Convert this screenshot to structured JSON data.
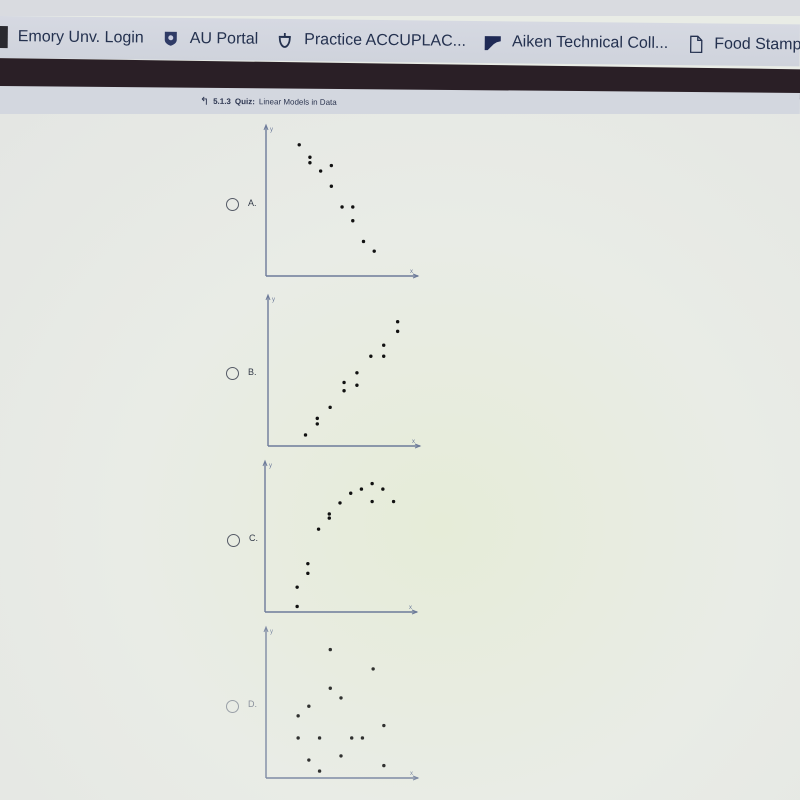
{
  "browser": {
    "bookmarks": [
      {
        "label": "Emory Unv. Login",
        "icon": "bookmark-edge-icon"
      },
      {
        "label": "AU Portal",
        "icon": "shield-icon"
      },
      {
        "label": "Practice ACCUPLAC...",
        "icon": "acorn-icon"
      },
      {
        "label": "Aiken Technical Coll...",
        "icon": "college-logo-icon"
      },
      {
        "label": "Food Stamps",
        "icon": "document-icon"
      }
    ]
  },
  "quiz": {
    "back_icon": "↰",
    "number": "5.1.3",
    "label": "Quiz:",
    "title": "Linear Models in Data"
  },
  "options": [
    {
      "letter": "A.",
      "xlabel": "x",
      "ylabel": "y",
      "points": [
        [
          3.1,
          9.5
        ],
        [
          4.1,
          8.6
        ],
        [
          4.1,
          8.2
        ],
        [
          5.1,
          7.6
        ],
        [
          6.1,
          8.0
        ],
        [
          6.1,
          6.5
        ],
        [
          7.1,
          5.0
        ],
        [
          8.1,
          5.0
        ],
        [
          8.1,
          4.0
        ],
        [
          9.1,
          2.5
        ],
        [
          10.1,
          1.8
        ]
      ]
    },
    {
      "letter": "B.",
      "xlabel": "x",
      "ylabel": "y",
      "points": [
        [
          3.5,
          0.8
        ],
        [
          4.6,
          1.6
        ],
        [
          4.6,
          2.0
        ],
        [
          5.8,
          2.8
        ],
        [
          7.1,
          4.0
        ],
        [
          7.1,
          4.6
        ],
        [
          8.3,
          4.4
        ],
        [
          8.3,
          5.3
        ],
        [
          9.6,
          6.5
        ],
        [
          10.8,
          7.3
        ],
        [
          10.8,
          6.5
        ],
        [
          12.1,
          8.3
        ],
        [
          12.1,
          9.0
        ]
      ]
    },
    {
      "letter": "C.",
      "xlabel": "x",
      "ylabel": "y",
      "points": [
        [
          3.0,
          0.4
        ],
        [
          3.0,
          1.8
        ],
        [
          4.0,
          2.8
        ],
        [
          4.0,
          3.5
        ],
        [
          5.0,
          6.0
        ],
        [
          6.0,
          6.8
        ],
        [
          6.0,
          7.1
        ],
        [
          7.0,
          7.9
        ],
        [
          8.0,
          8.6
        ],
        [
          9.0,
          8.9
        ],
        [
          10.0,
          9.3
        ],
        [
          11.0,
          8.9
        ],
        [
          10.0,
          8.0
        ],
        [
          12.0,
          8.0
        ]
      ]
    },
    {
      "letter": "D.",
      "xlabel": "x",
      "ylabel": "y",
      "points": [
        [
          6.0,
          9.3
        ],
        [
          10.0,
          7.9
        ],
        [
          6.0,
          6.5
        ],
        [
          7.0,
          5.8
        ],
        [
          4.0,
          5.2
        ],
        [
          3.0,
          4.5
        ],
        [
          11.0,
          3.8
        ],
        [
          3.0,
          2.9
        ],
        [
          5.0,
          2.9
        ],
        [
          8.0,
          2.9
        ],
        [
          9.0,
          2.9
        ],
        [
          4.0,
          1.3
        ],
        [
          7.0,
          1.6
        ],
        [
          11.0,
          0.9
        ],
        [
          5.0,
          0.5
        ]
      ]
    }
  ],
  "colors": {
    "dot": "#111111",
    "axis": "#6d7b9a"
  }
}
